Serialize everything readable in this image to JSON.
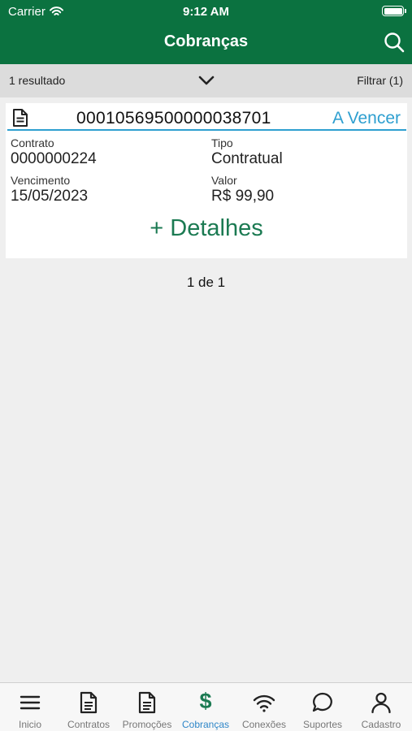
{
  "status_bar": {
    "carrier": "Carrier",
    "time": "9:12 AM"
  },
  "header": {
    "title": "Cobranças",
    "search_icon": "search-icon"
  },
  "filter_bar": {
    "result_count": "1 resultado",
    "filter_label": "Filtrar (1)"
  },
  "card": {
    "number": "00010569500000038701",
    "status": "A Vencer",
    "contrato_label": "Contrato",
    "contrato_value": "0000000224",
    "tipo_label": "Tipo",
    "tipo_value": "Contratual",
    "vencimento_label": "Vencimento",
    "vencimento_value": "15/05/2023",
    "valor_label": "Valor",
    "valor_value": "R$ 99,90",
    "details_label": "+ Detalhes"
  },
  "pagination": "1 de 1",
  "tabs": [
    {
      "label": "Inicio",
      "icon": "menu-icon"
    },
    {
      "label": "Contratos",
      "icon": "document-icon"
    },
    {
      "label": "Promoções",
      "icon": "document-icon"
    },
    {
      "label": "Cobranças",
      "icon": "dollar-icon",
      "active": true
    },
    {
      "label": "Conexões",
      "icon": "wifi-icon"
    },
    {
      "label": "Suportes",
      "icon": "chat-bubble-icon"
    },
    {
      "label": "Cadastro",
      "icon": "person-icon"
    }
  ],
  "colors": {
    "header_green": "#0b7240",
    "accent_blue": "#2e9fd0",
    "details_green": "#1b7a52",
    "active_tab": "#2e86c8"
  }
}
